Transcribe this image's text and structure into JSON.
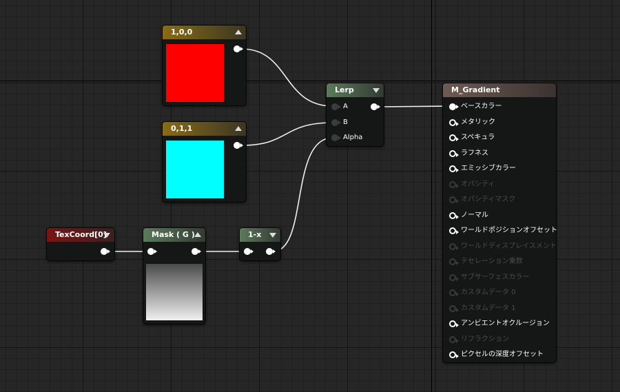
{
  "nodes": {
    "const_red": {
      "title": "1,0,0",
      "color": "#ff0000"
    },
    "const_cyan": {
      "title": "0,1,1",
      "color": "#00ffff"
    },
    "texcoord": {
      "title": "TexCoord[0]"
    },
    "mask": {
      "title": "Mask ( G )"
    },
    "one_minus": {
      "title": "1-x"
    },
    "lerp": {
      "title": "Lerp",
      "inputs": [
        "A",
        "B",
        "Alpha"
      ]
    },
    "material": {
      "title": "M_Gradient",
      "inputs": [
        {
          "label": "ベースカラー",
          "state": "connected"
        },
        {
          "label": "メタリック",
          "state": "active"
        },
        {
          "label": "スペキュラ",
          "state": "active"
        },
        {
          "label": "ラフネス",
          "state": "active"
        },
        {
          "label": "エミッシブカラー",
          "state": "active"
        },
        {
          "label": "オパシティ",
          "state": "disabled"
        },
        {
          "label": "オパシティマスク",
          "state": "disabled"
        },
        {
          "label": "ノーマル",
          "state": "active"
        },
        {
          "label": "ワールドポジションオフセット",
          "state": "active"
        },
        {
          "label": "ワールドディスプレイスメント",
          "state": "disabled"
        },
        {
          "label": "テセレーション乗数",
          "state": "disabled"
        },
        {
          "label": "サブサーフェスカラー",
          "state": "disabled"
        },
        {
          "label": "カスタムデータ 0",
          "state": "disabled"
        },
        {
          "label": "カスタムデータ 1",
          "state": "disabled"
        },
        {
          "label": "アンビエントオクルージョン",
          "state": "active"
        },
        {
          "label": "リフラクション",
          "state": "disabled"
        },
        {
          "label": "ピクセルの深度オフセット",
          "state": "active"
        }
      ]
    }
  }
}
